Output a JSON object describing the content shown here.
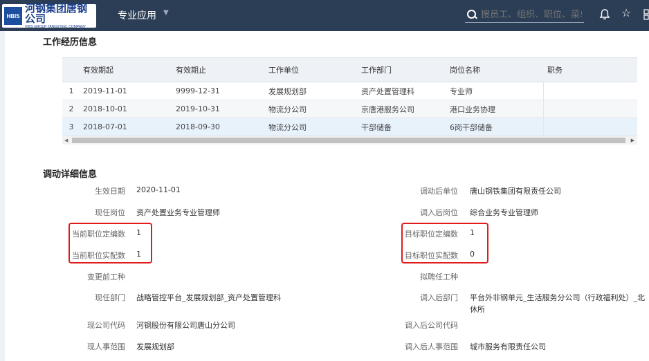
{
  "header": {
    "logo_mark": "HBIS",
    "logo_cn": "河钢集团唐钢公司",
    "logo_en": "HBIS GROUP TANGSTEEL COMPANY",
    "nav_title": "专业应用",
    "search_placeholder": "搜员工、组织、职位、菜单",
    "background_color": "#2c3e55"
  },
  "work_history": {
    "title": "工作经历信息",
    "columns": [
      "",
      "有效期起",
      "有效期止",
      "工作单位",
      "工作部门",
      "岗位名称",
      "职务"
    ],
    "rows": [
      {
        "index": "1",
        "start": "2019-11-01",
        "end": "9999-12-31",
        "unit": "发展规划部",
        "dept": "资产处置管理科",
        "post": "专业师",
        "duty": ""
      },
      {
        "index": "2",
        "start": "2018-10-01",
        "end": "2019-10-31",
        "unit": "物流分公司",
        "dept": "京唐港服务公司",
        "post": "港口业务协理",
        "duty": ""
      },
      {
        "index": "3",
        "start": "2018-07-01",
        "end": "2018-09-30",
        "unit": "物流分公司",
        "dept": "干部储备",
        "post": "6岗干部储备",
        "duty": ""
      }
    ]
  },
  "transfer": {
    "title": "调动详细信息",
    "left": [
      {
        "label": "生效日期",
        "value": "2020-11-01"
      },
      {
        "label": "现任岗位",
        "value": "资产处置业务专业管理师"
      },
      {
        "label": "当前职位定编数",
        "value": "1"
      },
      {
        "label": "当前职位实配数",
        "value": "1"
      },
      {
        "label": "变更前工种",
        "value": ""
      },
      {
        "label": "现任部门",
        "value": "战略管控平台_发展规划部_资产处置管理科"
      },
      {
        "label": "现公司代码",
        "value": "河钢股份有限公司唐山分公司"
      },
      {
        "label": "现人事范围",
        "value": "发展规划部"
      }
    ],
    "right": [
      {
        "label": "调动后单位",
        "value": "唐山钢铁集团有限责任公司"
      },
      {
        "label": "调入后岗位",
        "value": "综合业务专业管理师"
      },
      {
        "label": "目标职位定编数",
        "value": "1"
      },
      {
        "label": "目标职位实配数",
        "value": "0"
      },
      {
        "label": "拟聘任工种",
        "value": ""
      },
      {
        "label": "调入后部门",
        "value": "平台外非钢单元_生活服务分公司（行政福利处）_北",
        "value2": "休所"
      },
      {
        "label": "调入后公司代码",
        "value": ""
      },
      {
        "label": "调入后人事范围",
        "value": "城市服务有限责任公司"
      }
    ],
    "highlight_color": "#e11a1a"
  }
}
